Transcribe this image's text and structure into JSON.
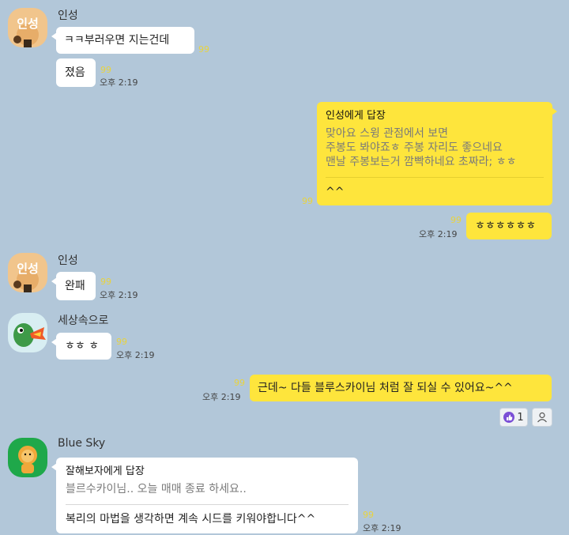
{
  "messages": {
    "m1": {
      "sender": "인성",
      "text": "ㅋㅋ부러우면 지는건데",
      "unread": "99"
    },
    "m2": {
      "text": "졌음",
      "unread": "99",
      "time": "오후 2:19"
    },
    "m3": {
      "reply_title": "인성에게 답장",
      "quote_lines": [
        "맞아요 스윙 관점에서 보면",
        "주봉도 봐야죠ㅎ 주봉 자리도 좋으네요",
        "맨날 주봉보는거 깜빡하네요 초짜라; ㅎㅎ"
      ],
      "text": "^^",
      "unread": "99"
    },
    "m4": {
      "text": "ㅎㅎㅎㅎㅎㅎ",
      "unread": "99",
      "time": "오후 2:19"
    },
    "m5": {
      "sender": "인성",
      "text": "완패",
      "unread": "99",
      "time": "오후 2:19"
    },
    "m6": {
      "sender": "세상속으로",
      "text": "ㅎㅎ ㅎ",
      "unread": "99",
      "time": "오후 2:19"
    },
    "m7": {
      "text": "근데~ 다들 블루스카이님 처럼 잘 되실 수 있어요~^^",
      "unread": "99",
      "time": "오후 2:19",
      "reaction_count": "1"
    },
    "m8": {
      "sender": "Blue Sky",
      "reply_title": "잘해보자에게 답장",
      "quote": "블르수카이님.. 오늘 매매 종료 하세요..",
      "text": "복리의 마법을 생각하면 계속 시드를 키워야합니다^^",
      "unread": "99",
      "time": "오후 2:19"
    }
  },
  "colors": {
    "background": "#b2c7d9",
    "my_bubble": "#fee53c",
    "other_bubble": "#ffffff",
    "unread": "#e8d33f"
  },
  "icons": {
    "avatar_ryan": "ryan-avatar",
    "avatar_dino": "dino-avatar",
    "thumbs_up": "thumbs-up-icon",
    "add_reaction": "person-icon"
  }
}
